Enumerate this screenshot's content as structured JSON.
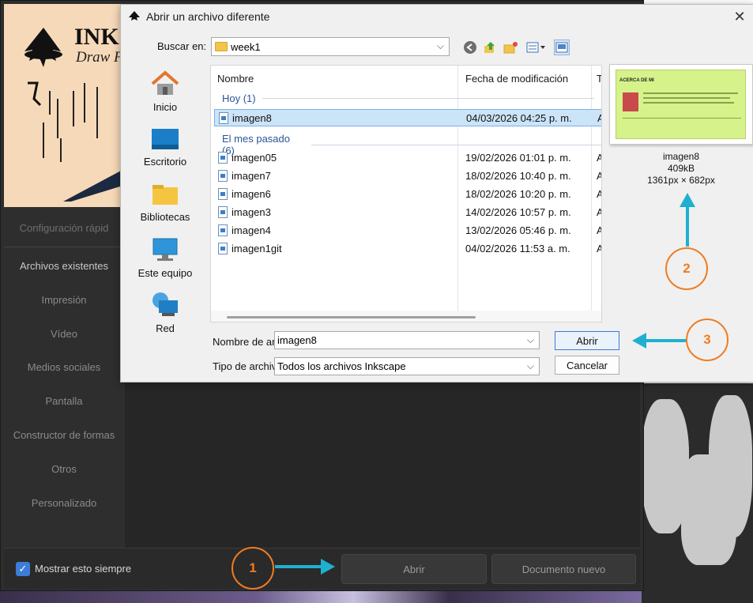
{
  "inkscape": {
    "logo_text": "INKS",
    "tagline": "Draw F",
    "sidebar": [
      "Configuración rápid",
      "Archivos existentes",
      "Impresión",
      "Vídeo",
      "Medios sociales",
      "Pantalla",
      "Constructor de formas",
      "Otros",
      "Personalizado"
    ],
    "show_always_label": "Mostrar esto siempre",
    "open_button": "Abrir",
    "new_doc_button": "Documento nuevo"
  },
  "dialog": {
    "title": "Abrir un archivo diferente",
    "close_glyph": "✕",
    "look_in_label": "Buscar en:",
    "look_in_value": "week1",
    "places": [
      "Inicio",
      "Escritorio",
      "Bibliotecas",
      "Este equipo",
      "Red"
    ],
    "columns": {
      "name": "Nombre",
      "date": "Fecha de modificación",
      "type": "T"
    },
    "groups": [
      {
        "label": "Hoy (1)",
        "files": [
          {
            "name": "imagen8",
            "date": "04/03/2026 04:25 p. m.",
            "type": "A",
            "selected": true
          }
        ]
      },
      {
        "label": "El mes pasado (6)",
        "files": [
          {
            "name": "imagen05",
            "date": "19/02/2026 01:01 p. m.",
            "type": "A"
          },
          {
            "name": "imagen7",
            "date": "18/02/2026 10:40 p. m.",
            "type": "A"
          },
          {
            "name": "imagen6",
            "date": "18/02/2026 10:20 p. m.",
            "type": "A"
          },
          {
            "name": "imagen3",
            "date": "14/02/2026 10:57 p. m.",
            "type": "A"
          },
          {
            "name": "imagen4",
            "date": "13/02/2026 05:46 p. m.",
            "type": "A"
          },
          {
            "name": "imagen1git",
            "date": "04/02/2026 11:53 a. m.",
            "type": "A"
          }
        ]
      }
    ],
    "preview": {
      "name": "imagen8",
      "size": "409kB",
      "dimensions": "1361px × 682px",
      "thumb_heading": "ACERCA DE MI"
    },
    "filename_label": "Nombre de arc",
    "filename_value": "imagen8",
    "filetype_label": "Tipo de archiv",
    "filetype_value": "Todos los archivos Inkscape",
    "open_button": "Abrir",
    "cancel_button": "Cancelar"
  },
  "annotations": {
    "step1": "1",
    "step2": "2",
    "step3": "3",
    "accent": "#f07c22",
    "arrow_color": "#1fb0d0"
  }
}
